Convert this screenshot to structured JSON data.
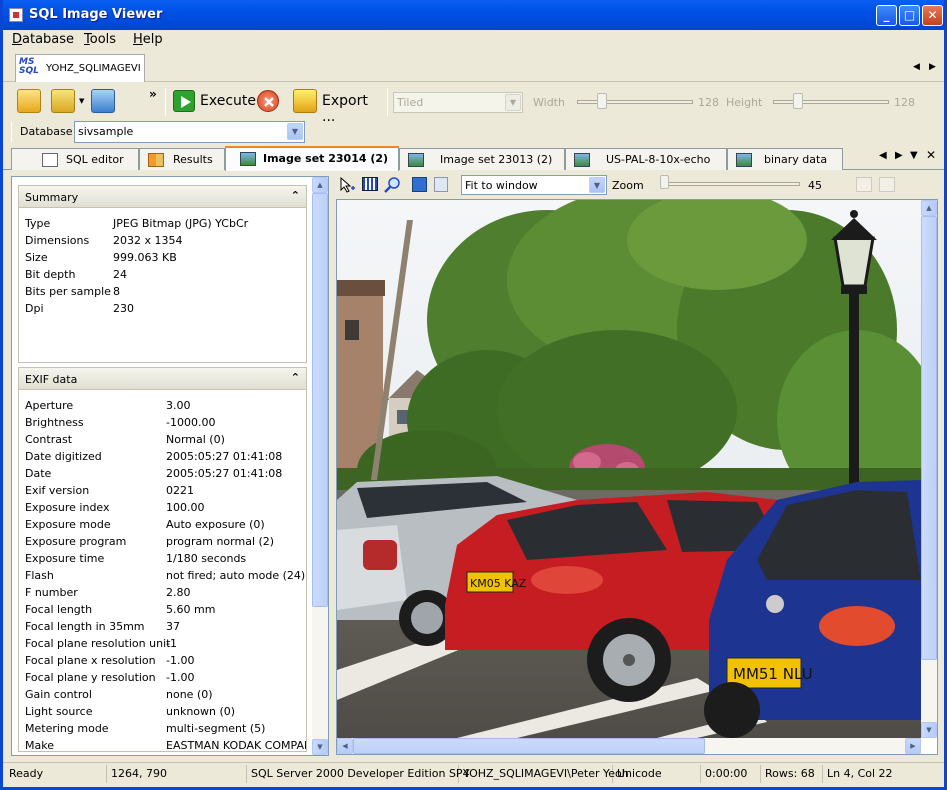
{
  "window": {
    "title": "SQL Image Viewer"
  },
  "menu": [
    "Database",
    "Tools",
    "Help"
  ],
  "connection": {
    "tab_label": "YOHZ_SQLIMAGEVI",
    "logo_top": "MS",
    "logo_bottom": "SQL"
  },
  "toolbar": {
    "execute_label": "Execute",
    "export_label": "Export ...",
    "overflow": "»",
    "layout_select": "Tiled",
    "width_label": "Width",
    "width_value": "128",
    "height_label": "Height",
    "height_value": "128"
  },
  "database": {
    "label": "Database",
    "value": "sivsample"
  },
  "tabs": [
    {
      "label": "SQL editor"
    },
    {
      "label": "Results"
    },
    {
      "label": "Image set 23014 (2)",
      "active": true
    },
    {
      "label": "Image set 23013 (2)"
    },
    {
      "label": "US-PAL-8-10x-echo"
    },
    {
      "label": "binary data"
    }
  ],
  "summary": {
    "title": "Summary",
    "rows": [
      {
        "k": "Type",
        "v": "JPEG Bitmap (JPG) YCbCr"
      },
      {
        "k": "Dimensions",
        "v": "2032 x 1354"
      },
      {
        "k": "Size",
        "v": "999.063 KB"
      },
      {
        "k": "Bit depth",
        "v": "24"
      },
      {
        "k": "Bits per sample",
        "v": "8"
      },
      {
        "k": "Dpi",
        "v": "230"
      }
    ]
  },
  "exif": {
    "title": "EXIF data",
    "rows": [
      {
        "k": "Aperture",
        "v": "3.00"
      },
      {
        "k": "Brightness",
        "v": "-1000.00"
      },
      {
        "k": "Contrast",
        "v": "Normal (0)"
      },
      {
        "k": "Date digitized",
        "v": "2005:05:27 01:41:08"
      },
      {
        "k": "Date",
        "v": "2005:05:27 01:41:08"
      },
      {
        "k": "Exif version",
        "v": "0221"
      },
      {
        "k": "Exposure index",
        "v": "100.00"
      },
      {
        "k": "Exposure mode",
        "v": "Auto exposure (0)"
      },
      {
        "k": "Exposure program",
        "v": "program normal (2)"
      },
      {
        "k": "Exposure time",
        "v": "1/180 seconds"
      },
      {
        "k": "Flash",
        "v": "not fired; auto mode (24)"
      },
      {
        "k": "F number",
        "v": "2.80"
      },
      {
        "k": "Focal length",
        "v": "5.60 mm"
      },
      {
        "k": "Focal length in 35mm",
        "v": "37"
      },
      {
        "k": "Focal plane resolution unit",
        "v": "-1"
      },
      {
        "k": "Focal plane x resolution",
        "v": "-1.00"
      },
      {
        "k": "Focal plane y resolution",
        "v": "-1.00"
      },
      {
        "k": "Gain control",
        "v": "none (0)"
      },
      {
        "k": "Light source",
        "v": "unknown (0)"
      },
      {
        "k": "Metering mode",
        "v": "multi-segment (5)"
      },
      {
        "k": "Make",
        "v": "EASTMAN KODAK COMPANY"
      }
    ]
  },
  "viewer": {
    "fit_select": "Fit to window",
    "zoom_label": "Zoom",
    "zoom_value": "45",
    "plate_red_car": "KM05 KAZ",
    "plate_blue_car": "MM51 NLU"
  },
  "status": {
    "state": "Ready",
    "coords": "1264, 790",
    "server": "SQL Server 2000 Developer Edition SP4",
    "user": "YOHZ_SQLIMAGEVI\\Peter Yeoh",
    "encoding": "Unicode",
    "elapsed": "0:00:00",
    "rows": "Rows: 68",
    "cursor": "Ln 4, Col 22"
  }
}
